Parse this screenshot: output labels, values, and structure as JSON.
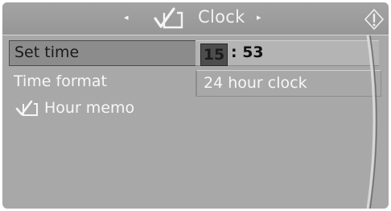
{
  "header": {
    "title": "Clock",
    "left_arrow": "◂",
    "right_arrow": "▸",
    "icons": [
      "checkmark-box-icon",
      "info-icon"
    ]
  },
  "menu": {
    "set_time": {
      "label": "Set time",
      "hour": "15",
      "minutes_display": ": 53"
    },
    "time_format": {
      "label": "Time format",
      "value": "24 hour clock"
    },
    "hour_memo": {
      "label": "Hour memo",
      "icon": "checkmark-icon"
    }
  },
  "colors": {
    "background": "#a8a8a8",
    "selected_row": "#8c8c8c",
    "hour_highlight": "#4d4d4d",
    "text_light": "#f7f7f7",
    "text_dark": "#1a1a1a"
  }
}
